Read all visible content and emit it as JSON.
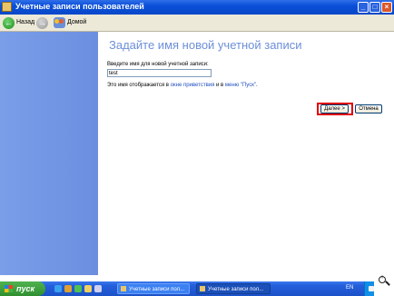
{
  "window": {
    "title": "Учетные записи пользователей",
    "min_label": "_",
    "max_label": "□",
    "close_label": "×"
  },
  "toolbar": {
    "back_label": "Назад",
    "home_label": "Домой"
  },
  "main": {
    "heading": "Задайте имя новой учетной записи",
    "field_label": "Введите имя для новой учетной записи:",
    "field_value": "test",
    "hint_prefix": "Это имя отображается в ",
    "hint_link1": "окне приветствия",
    "hint_middle": " и в ",
    "hint_link2": "меню \"Пуск\"",
    "hint_suffix": ".",
    "next_label": "Далее >",
    "cancel_label": "Отмена"
  },
  "taskbar": {
    "start_label": "пуск",
    "tasks": [
      {
        "label": "Учетные записи пол..."
      },
      {
        "label": "Учетные записи пол..."
      }
    ],
    "lang": "EN"
  },
  "colors": {
    "heading": "#6d8fd8",
    "highlight": "#e00000",
    "left_pane": "#7a9ee8"
  }
}
